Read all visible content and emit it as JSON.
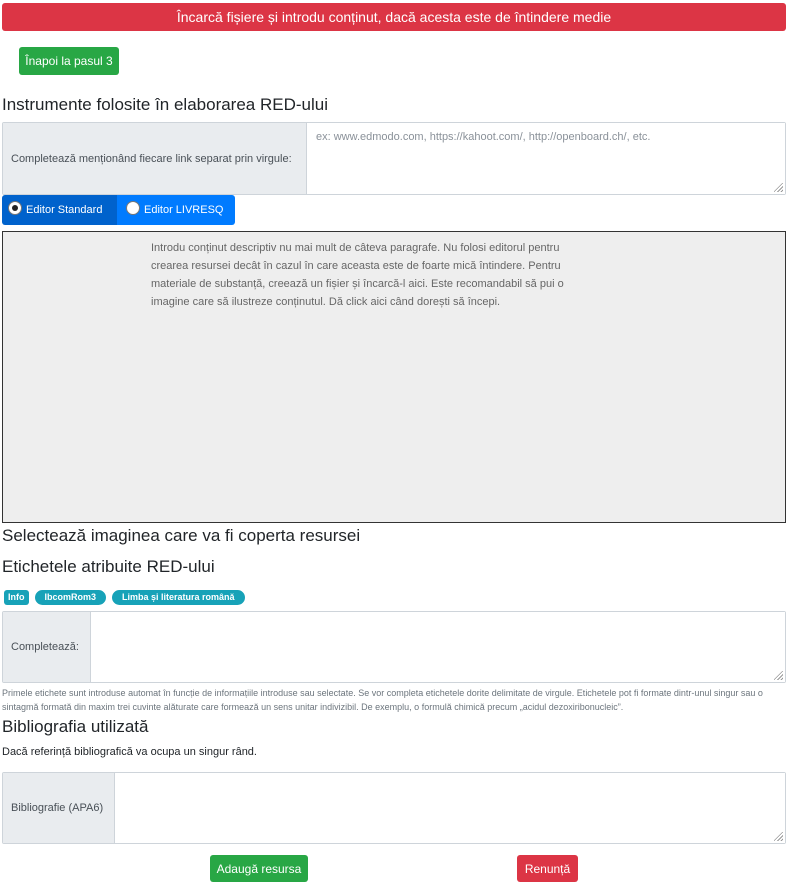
{
  "banner": {
    "text": "Încarcă fișiere și introdu conținut, dacă acesta este de întindere medie"
  },
  "back_button": {
    "label": "Înapoi la pasul 3"
  },
  "tools": {
    "heading": "Instrumente folosite în elaborarea RED-ului",
    "label": "Completează menționând fiecare link separat prin virgule:",
    "placeholder": "ex: www.edmodo.com, https://kahoot.com/, http://openboard.ch/, etc."
  },
  "editor": {
    "options": [
      {
        "label": "Editor Standard",
        "selected": true
      },
      {
        "label": "Editor LIVRESQ",
        "selected": false
      }
    ],
    "placeholder": "Introdu conținut descriptiv nu mai mult de câteva paragrafe. Nu folosi editorul pentru crearea resursei decât în cazul în care aceasta este de foarte mică întindere. Pentru materiale de substanță, creează un fișier și încarcă-l aici. Este recomandabil să pui o imagine care să ilustreze conținutul. Dă click aici când dorești să începi."
  },
  "cover": {
    "heading": "Selectează imaginea care va fi coperta resursei"
  },
  "tags": {
    "heading": "Etichetele atribuite RED-ului",
    "items": [
      "Info",
      "lbcomRom3",
      "Limba și literatura română"
    ],
    "label": "Completează:",
    "help": "Primele etichete sunt introduse automat în funcție de informațiile introduse sau selectate. Se vor completa etichetele dorite delimitate de virgule. Etichetele pot fi formate dintr-unul singur sau o sintagmă formată din maxim trei cuvinte alăturate care formează un sens unitar indivizibil. De exemplu, o formulă chimică precum „acidul dezoxiribonucleic”."
  },
  "bibliography": {
    "heading": "Bibliografia utilizată",
    "subtext": "Dacă referință bibliografică va ocupa un singur rând.",
    "label": "Bibliografie (APA6)"
  },
  "actions": {
    "submit_label": "Adaugă resursa",
    "cancel_label": "Renunță"
  },
  "colors": {
    "danger": "#dc3545",
    "success": "#28a745",
    "primary": "#007bff",
    "info": "#17a2b8"
  }
}
